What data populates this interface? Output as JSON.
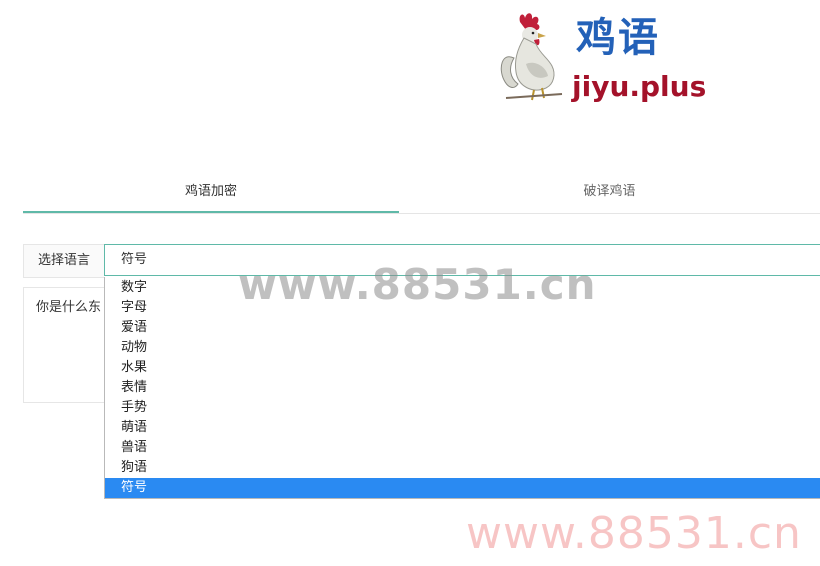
{
  "logo": {
    "name": "鸡语",
    "domain": "jiyu.plus",
    "brand_blue": "#2361b8",
    "brand_red": "#a4122a"
  },
  "tabs": [
    {
      "label": "鸡语加密",
      "active": true
    },
    {
      "label": "破译鸡语",
      "active": false
    }
  ],
  "language": {
    "label": "选择语言",
    "selected": "符号",
    "options": [
      "数字",
      "字母",
      "爱语",
      "动物",
      "水果",
      "表情",
      "手势",
      "萌语",
      "兽语",
      "狗语",
      "符号"
    ],
    "selected_index": 10
  },
  "input": {
    "value": "你是什么东"
  },
  "watermarks": {
    "center": "www.88531.cn",
    "bottom": "www.88531.cn"
  },
  "colors": {
    "accent": "#5fb9a8",
    "highlight": "#2a8af2"
  }
}
